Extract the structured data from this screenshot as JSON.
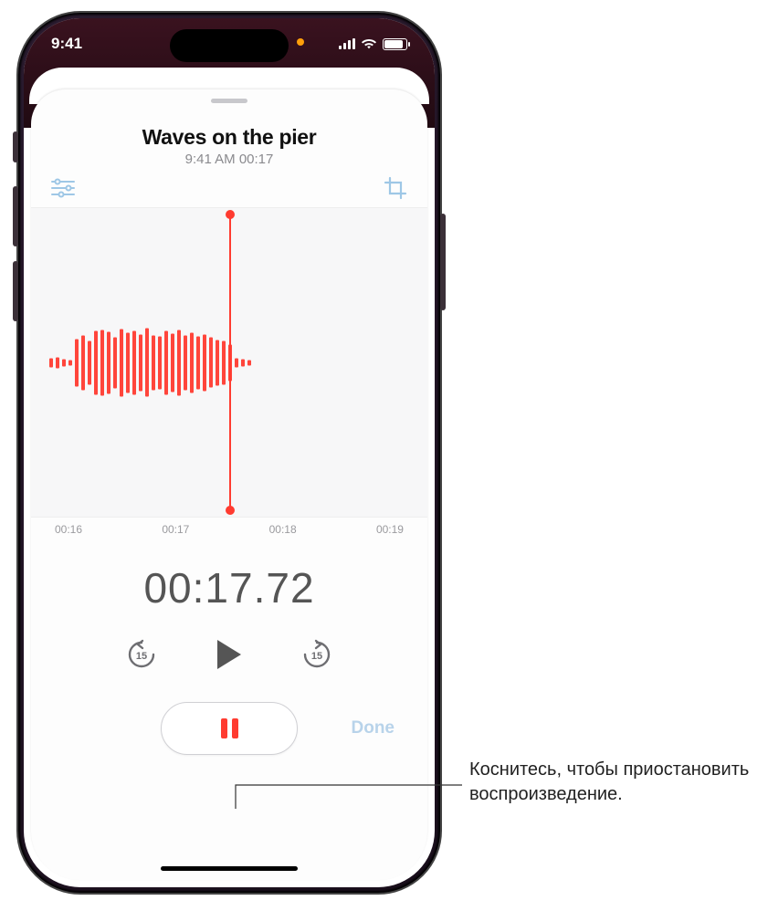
{
  "status": {
    "time": "9:41"
  },
  "recording": {
    "title": "Waves on the pier",
    "subtitle": "9:41 AM  00:17"
  },
  "ticks": {
    "t0": "00:16",
    "t1": "00:17",
    "t2": "00:18",
    "t3": "00:19"
  },
  "big_time": "00:17.72",
  "buttons": {
    "done": "Done"
  },
  "callout": {
    "text": "Коснитесь, чтобы приостановить воспроизведение."
  }
}
